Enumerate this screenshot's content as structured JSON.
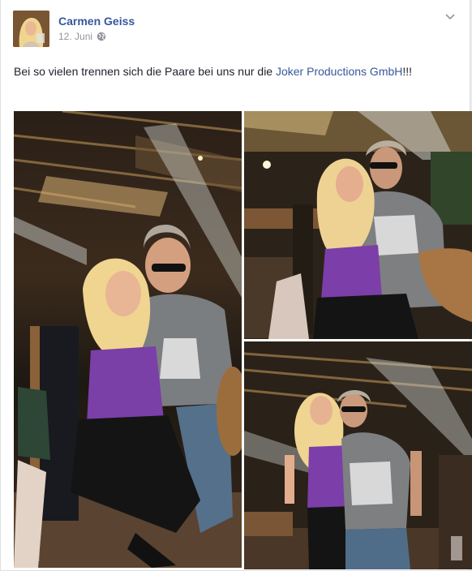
{
  "post": {
    "author": "Carmen Geiss",
    "date": "12. Juni",
    "audience_icon": "globe-icon",
    "menu_icon": "chevron-down-icon",
    "text_before_link": "Bei so vielen trennen sich die Paare bei uns nur die ",
    "link_text": "Joker Productions GmbH",
    "text_after_link": "!!!",
    "photo_count": 3
  },
  "colors": {
    "link": "#365899",
    "meta": "#90949c",
    "text": "#1d2129",
    "background": "#e9ebee"
  }
}
